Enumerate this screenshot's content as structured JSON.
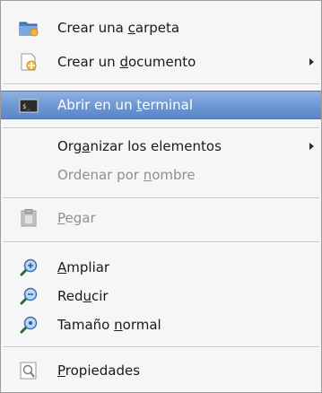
{
  "menu": {
    "items": [
      {
        "id": "crear-carpeta",
        "pre": "Crear una ",
        "ul": "c",
        "post": "arpeta",
        "icon": "folder-new-icon",
        "submenu": false
      },
      {
        "id": "crear-documento",
        "pre": "Crear un ",
        "ul": "d",
        "post": "ocumento",
        "icon": "document-new-icon",
        "submenu": true
      },
      {
        "id": "abrir-terminal",
        "pre": "Abrir en un ",
        "ul": "t",
        "post": "erminal",
        "icon": "terminal-icon",
        "submenu": false
      },
      {
        "id": "organizar",
        "pre": "Org",
        "ul": "a",
        "post": "nizar los elementos",
        "icon": "",
        "submenu": true
      },
      {
        "id": "ordenar",
        "pre": "Ordenar por ",
        "ul": "n",
        "post": "ombre",
        "icon": "",
        "submenu": false,
        "disabled": true
      },
      {
        "id": "pegar",
        "pre": "",
        "ul": "P",
        "post": "egar",
        "icon": "paste-icon",
        "submenu": false,
        "disabled": true
      },
      {
        "id": "ampliar",
        "pre": "",
        "ul": "A",
        "post": "mpliar",
        "icon": "zoom-in-icon",
        "submenu": false
      },
      {
        "id": "reducir",
        "pre": "Red",
        "ul": "u",
        "post": "cir",
        "icon": "zoom-out-icon",
        "submenu": false
      },
      {
        "id": "tamano-normal",
        "pre": "Tamaño ",
        "ul": "n",
        "post": "ormal",
        "icon": "zoom-original-icon",
        "submenu": false
      },
      {
        "id": "propiedades",
        "pre": "",
        "ul": "P",
        "post": "ropiedades",
        "icon": "properties-icon",
        "submenu": false
      }
    ]
  },
  "colors": {
    "highlight": "#6a95d1",
    "disabled_text": "#8f8f8f"
  }
}
